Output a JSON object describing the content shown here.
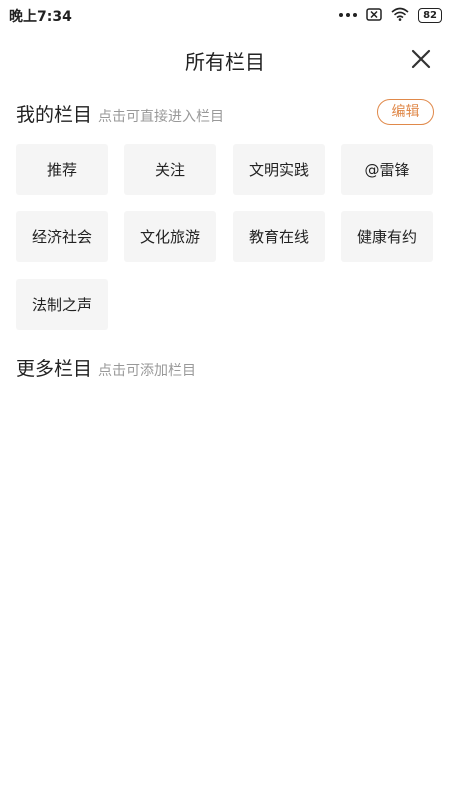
{
  "status_bar": {
    "time": "晚上7:34",
    "battery": "82",
    "icons": [
      "more-dots-icon",
      "no-sim-icon",
      "wifi-icon",
      "battery-icon"
    ]
  },
  "header": {
    "title": "所有栏目",
    "close_icon": "close-icon"
  },
  "my_channels": {
    "title": "我的栏目",
    "hint": "点击可直接进入栏目",
    "edit_label": "编辑",
    "items": [
      {
        "label": "推荐"
      },
      {
        "label": "关注"
      },
      {
        "label": "文明实践"
      },
      {
        "label": "@雷锋"
      },
      {
        "label": "经济社会"
      },
      {
        "label": "文化旅游"
      },
      {
        "label": "教育在线"
      },
      {
        "label": "健康有约"
      },
      {
        "label": "法制之声"
      }
    ]
  },
  "more_channels": {
    "title": "更多栏目",
    "hint": "点击可添加栏目"
  },
  "colors": {
    "accent": "#e0894a",
    "tile_bg": "#f5f5f5",
    "hint_text": "#999999"
  }
}
